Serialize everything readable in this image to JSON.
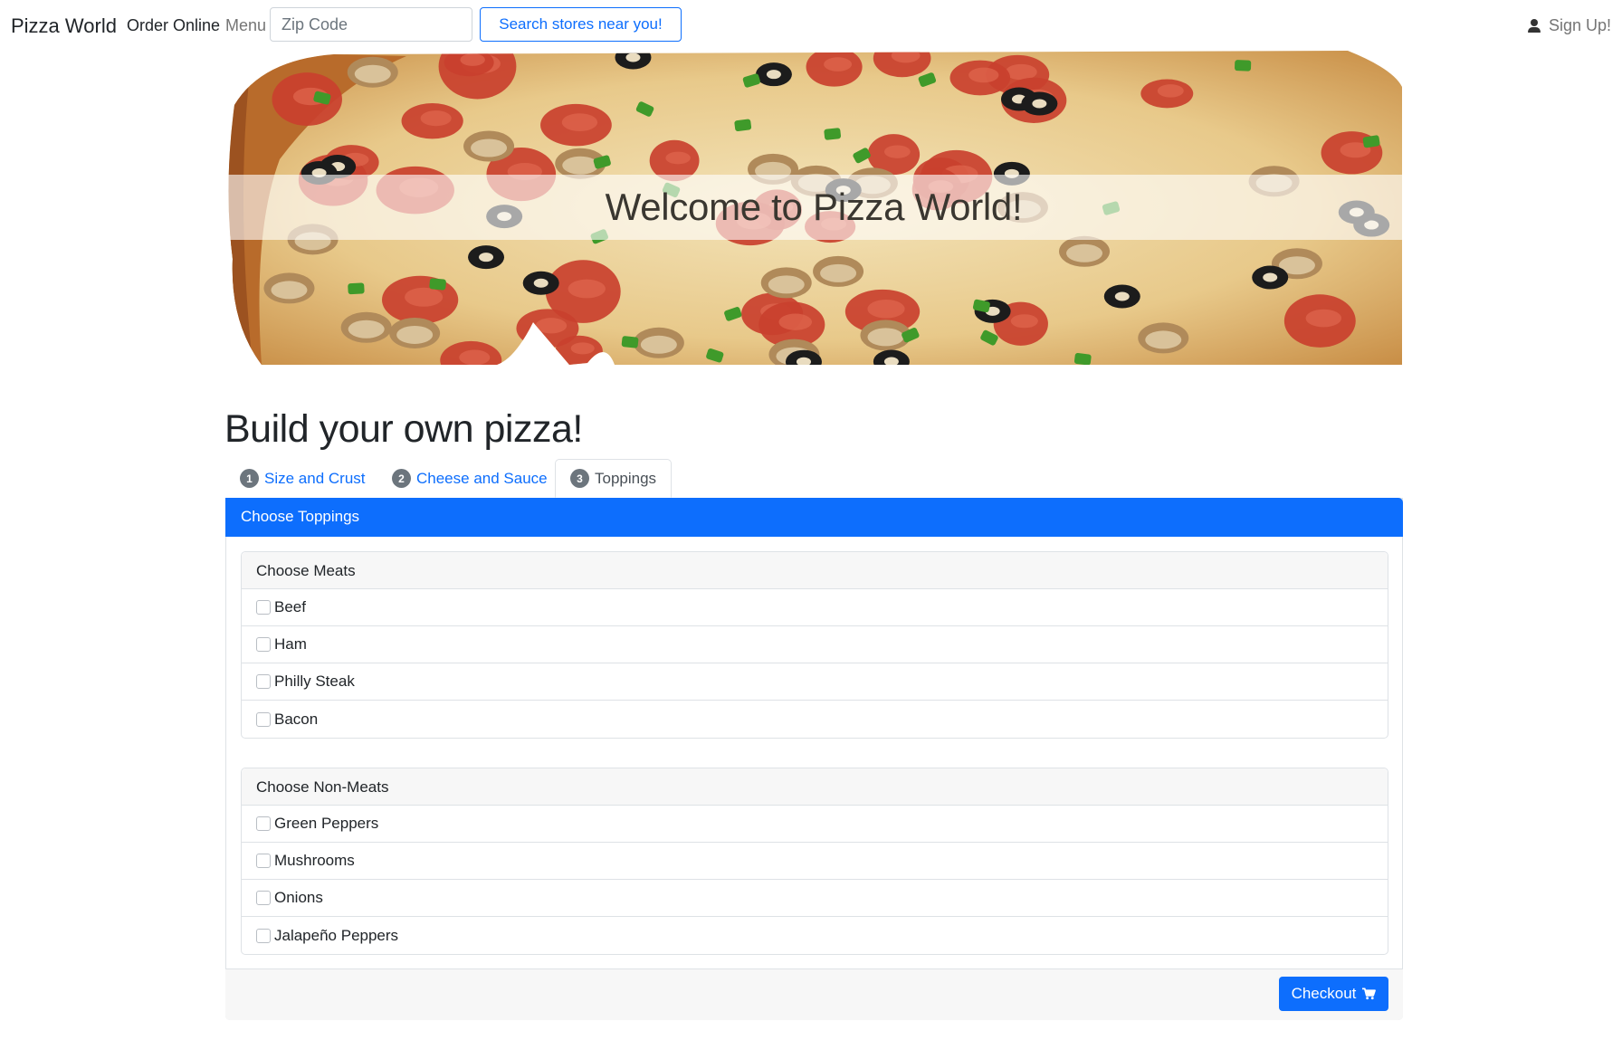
{
  "navbar": {
    "brand": "Pizza World",
    "order_online": "Order Online",
    "menu": "Menu",
    "zip_placeholder": "Zip Code",
    "search_button": "Search stores near you!",
    "signup": "Sign Up!"
  },
  "hero": {
    "title": "Welcome to Pizza World!"
  },
  "builder": {
    "title": "Build your own pizza!",
    "tabs": [
      {
        "number": "1",
        "label": "Size and Crust"
      },
      {
        "number": "2",
        "label": "Cheese and Sauce"
      },
      {
        "number": "3",
        "label": "Toppings"
      }
    ],
    "active_tab": "Toppings",
    "card_title": "Choose Toppings",
    "meats": {
      "header": "Choose Meats",
      "items": [
        "Beef",
        "Ham",
        "Philly Steak",
        "Bacon"
      ]
    },
    "non_meats": {
      "header": "Choose Non-Meats",
      "items": [
        "Green Peppers",
        "Mushrooms",
        "Onions",
        "Jalapeño Peppers"
      ]
    },
    "checkout": "Checkout"
  },
  "colors": {
    "primary": "#0d6efd",
    "muted": "#6c757d",
    "border": "#dee2e6"
  }
}
